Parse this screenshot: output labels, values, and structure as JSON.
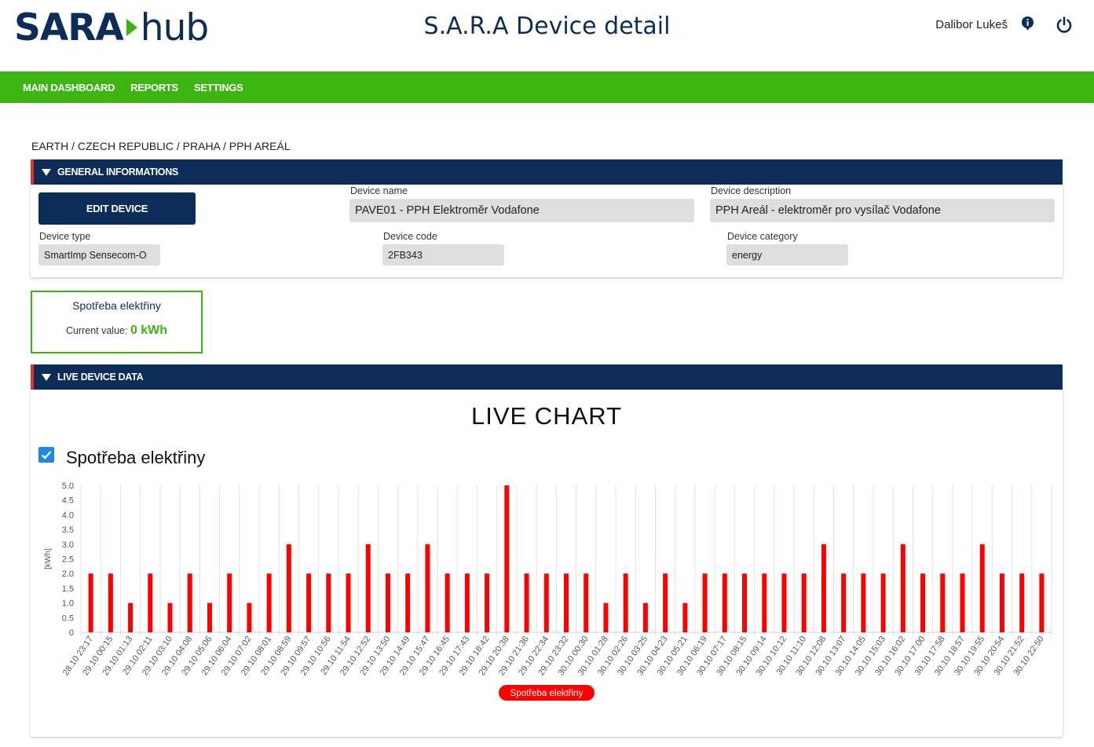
{
  "header": {
    "logo_left": "SARA",
    "logo_right": "hub",
    "title": "S.A.R.A Device detail",
    "user": "Dalibor Lukeš"
  },
  "nav": {
    "items": [
      {
        "label": "MAIN DASHBOARD"
      },
      {
        "label": "REPORTS"
      },
      {
        "label": "SETTINGS"
      }
    ]
  },
  "breadcrumb": "EARTH / CZECH REPUBLIC / PRAHA / PPH AREÁL",
  "general": {
    "title": "GENERAL INFORMATIONS",
    "edit_button": "EDIT DEVICE",
    "device_name_label": "Device name",
    "device_name": "PAVE01 - PPH Elektroměr Vodafone",
    "device_description_label": "Device description",
    "device_description": "PPH Areál - elektroměr pro vysílač Vodafone",
    "device_type_label": "Device type",
    "device_type": "SmartImp Sensecom-O",
    "device_code_label": "Device code",
    "device_code": "2FB343",
    "device_category_label": "Device category",
    "device_category": "energy"
  },
  "value_card": {
    "title": "Spotřeba elektřiny",
    "current_label": "Current value:",
    "current_value": "0 kWh"
  },
  "live": {
    "title": "LIVE DEVICE DATA",
    "chart_title": "LIVE CHART",
    "series_label": "Spotřeba elektřiny"
  },
  "colors": {
    "navy": "#0c2d57",
    "green": "#3cb412",
    "red_accent": "#e4322b",
    "bar": "#ff0000",
    "checkbox": "#1e88e5"
  },
  "icons": {
    "info": "info-icon",
    "power": "power-icon",
    "collapse": "triangle-down-icon",
    "checkbox": "checkmark-icon"
  },
  "chart_data": {
    "type": "bar",
    "title": "",
    "xlabel": "",
    "ylabel": "[kWh]",
    "ylim": [
      0,
      5
    ],
    "yticks": [
      "0",
      "0.5",
      "1.0",
      "1.5",
      "2.0",
      "2.5",
      "3.0",
      "3.5",
      "4.0",
      "4.5",
      "5.0"
    ],
    "grid": "vertical",
    "legend": "bottom-center",
    "categories": [
      "28.10 23:17",
      "29.10 00:15",
      "29.10 01:13",
      "29.10 02:11",
      "29.10 03:10",
      "29.10 04:08",
      "29.10 05:06",
      "29.10 06:04",
      "29.10 07:02",
      "29.10 08:01",
      "29.10 08:59",
      "29.10 09:57",
      "29.10 10:56",
      "29.10 11:54",
      "29.10 12:52",
      "29.10 13:50",
      "29.10 14:49",
      "29.10 15:47",
      "29.10 16:45",
      "29.10 17:43",
      "29.10 18:42",
      "29.10 20:38",
      "29.10 21:36",
      "29.10 22:34",
      "29.10 23:32",
      "30.10 00:30",
      "30.10 01:28",
      "30.10 02:26",
      "30.10 03:25",
      "30.10 04:23",
      "30.10 05:21",
      "30.10 06:19",
      "30.10 07:17",
      "30.10 08:15",
      "30.10 09:14",
      "30.10 10:12",
      "30.10 11:10",
      "30.10 12:08",
      "30.10 13:07",
      "30.10 14:05",
      "30.10 15:03",
      "30.10 16:02",
      "30.10 17:00",
      "30.10 17:58",
      "30.10 18:57",
      "30.10 19:55",
      "30.10 20:54",
      "30.10 21:52",
      "30.10 22:50"
    ],
    "series": [
      {
        "name": "Spotřeba elektřiny",
        "color": "#ff0000",
        "values": [
          2,
          2,
          1,
          2,
          1,
          2,
          1,
          2,
          1,
          2,
          3,
          2,
          2,
          2,
          3,
          2,
          2,
          3,
          2,
          2,
          2,
          5,
          2,
          2,
          2,
          2,
          1,
          2,
          1,
          2,
          1,
          2,
          2,
          2,
          2,
          2,
          2,
          3,
          2,
          2,
          2,
          3,
          2,
          2,
          2,
          3,
          2,
          2,
          2
        ]
      }
    ]
  }
}
